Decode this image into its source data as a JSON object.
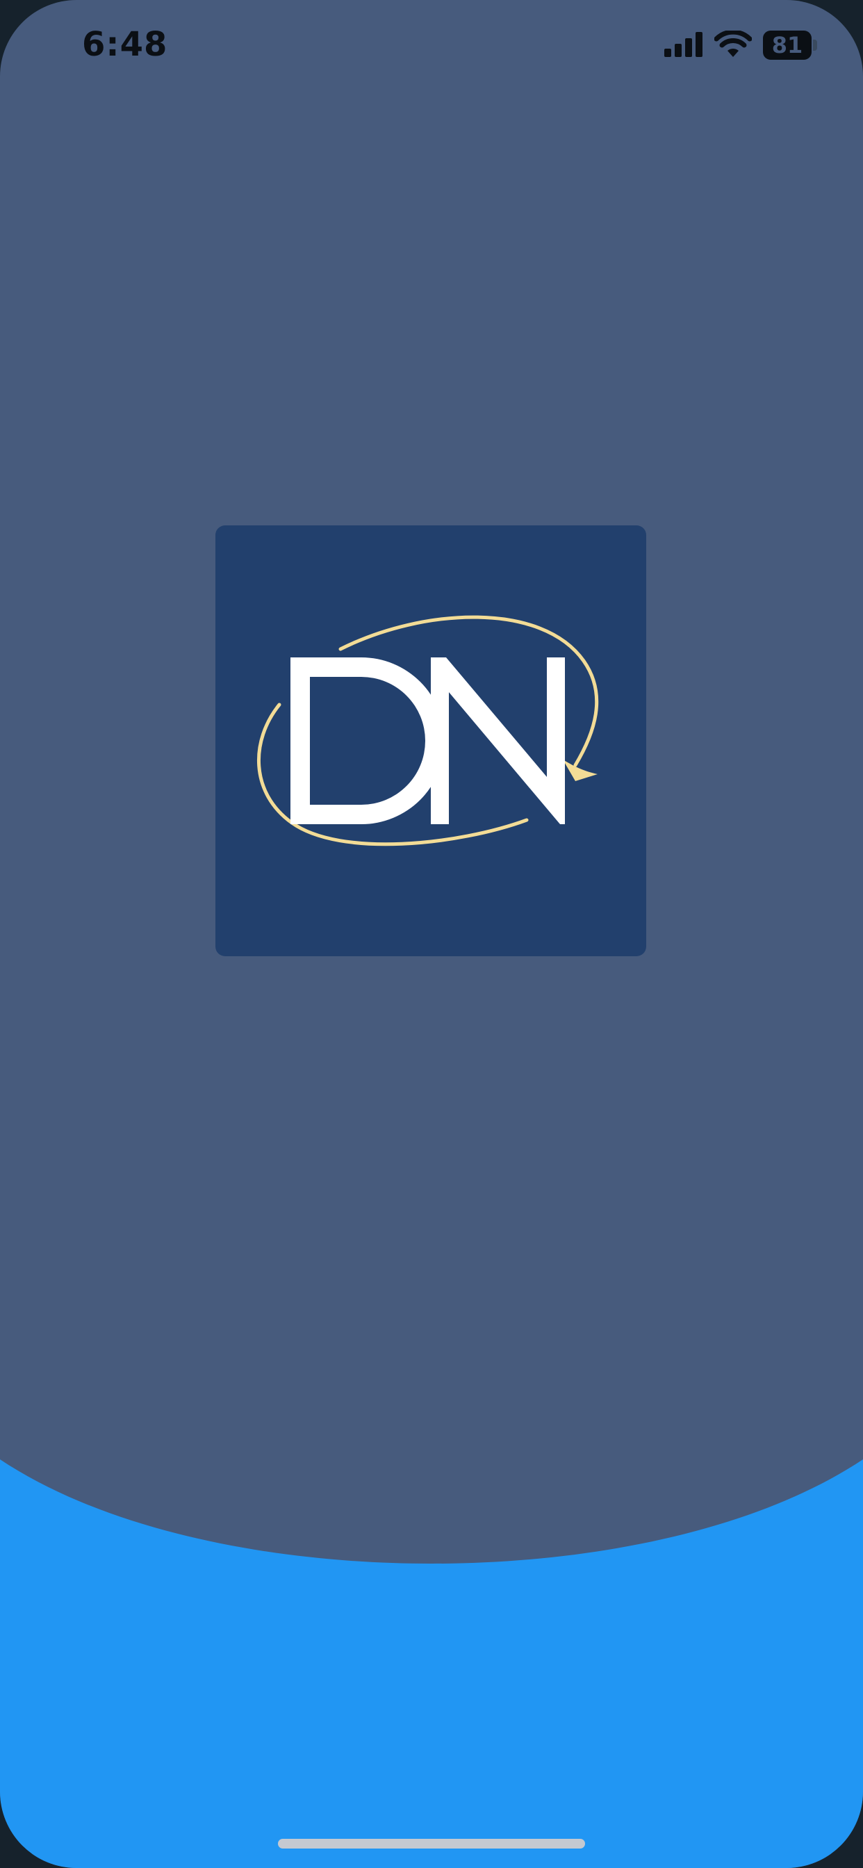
{
  "status_bar": {
    "time": "6:48",
    "battery_level": "81",
    "icons": [
      "signal-icon",
      "wifi-icon",
      "battery-icon"
    ]
  },
  "logo": {
    "letters": "DN",
    "icon": "dn-logo-icon"
  },
  "colors": {
    "background_top": "#475b7d",
    "background_bottom": "#2196f3",
    "logo_tile": "#22406d",
    "logo_letters": "#ffffff",
    "logo_orbit": "#f3dc96"
  }
}
